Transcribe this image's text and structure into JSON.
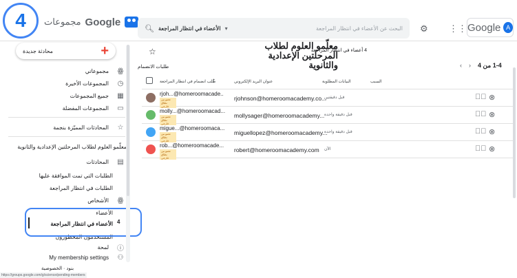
{
  "step_number": "4",
  "header": {
    "brand_google": "Google",
    "brand_name": "مجموعات",
    "search_placeholder": "البحث عن الأعضاء في انتظار المراجعة",
    "search_filter": "الأعضاء في انتظار المراجعة",
    "logo_text": "Google",
    "account_initial": "A"
  },
  "sidebar": {
    "new_chat": "محادثة جديدة",
    "items": [
      {
        "label": "مجموعاتي",
        "icon": "people-icon"
      },
      {
        "label": "المجموعات الأخيرة",
        "icon": "clock-icon"
      },
      {
        "label": "جميع المجموعات",
        "icon": "grid-icon"
      },
      {
        "label": "المجموعات المفضلة",
        "icon": "folder-icon"
      },
      {
        "label": "المحادثات المميّزة بنجمة",
        "icon": "star-icon"
      }
    ],
    "group_name": "معلّمو العلوم لطلاب المرحلتين الإعدادية والثانوية",
    "conversations": "المحادثات",
    "approved_posts": "الطلبات التي تمت الموافقة عليها",
    "pending_posts": "الطلبات في انتظار المراجعة",
    "people": "الأشخاص",
    "members": "الأعضاء",
    "pending_members": "الأعضاء في انتظار المراجعة",
    "pending_count": "4",
    "banned_users": "المستخدمون المحظورون",
    "about": "لمحة",
    "settings": "My membership settings",
    "footer_terms": "بنود · الخصوصية",
    "footer_url": "https://groups.google.com/g/science/pending-members"
  },
  "main": {
    "group_title": "معلّمو العلوم لطلاب المرحلتين الإعدادية والثانوية",
    "member_count": "4 أعضاء في انتظار المراجعة",
    "pending_label": "طلبات الانضمام",
    "pager": "1-4 من 4",
    "columns": {
      "request": "طلب انضمام في انتظار المراجعة",
      "email": "عنوان البريد الإلكتروني",
      "data": "البيانات المطلوبة",
      "reason": "السبب"
    },
    "rows": [
      {
        "name": "rjoh...@homeroomacade..",
        "tag": "عضو من نطاق خارجي",
        "email": "rjohnson@homeroomacademy.co...",
        "when": "قبل دقيقتين",
        "avatar_color": "#8d6e63"
      },
      {
        "name": "molly...@homeroomacad...",
        "tag": "عضو من نطاق خارجي",
        "email": "mollysager@homeroomacademy...",
        "when": "قبل دقيقة واحدة",
        "avatar_color": "#66bb6a"
      },
      {
        "name": "migue...@homeroomaca...",
        "tag": "عضو من نطاق خارجي",
        "email": "miguellopez@homeroomacademy...",
        "when": "قبل دقيقة واحدة",
        "avatar_color": "#42a5f5"
      },
      {
        "name": "rob...@homeroomacade...",
        "tag": "عضو من نطاق خارجي",
        "email": "robert@homeroomacademy.com",
        "when": "الآن",
        "avatar_color": "#ef5350"
      }
    ]
  }
}
